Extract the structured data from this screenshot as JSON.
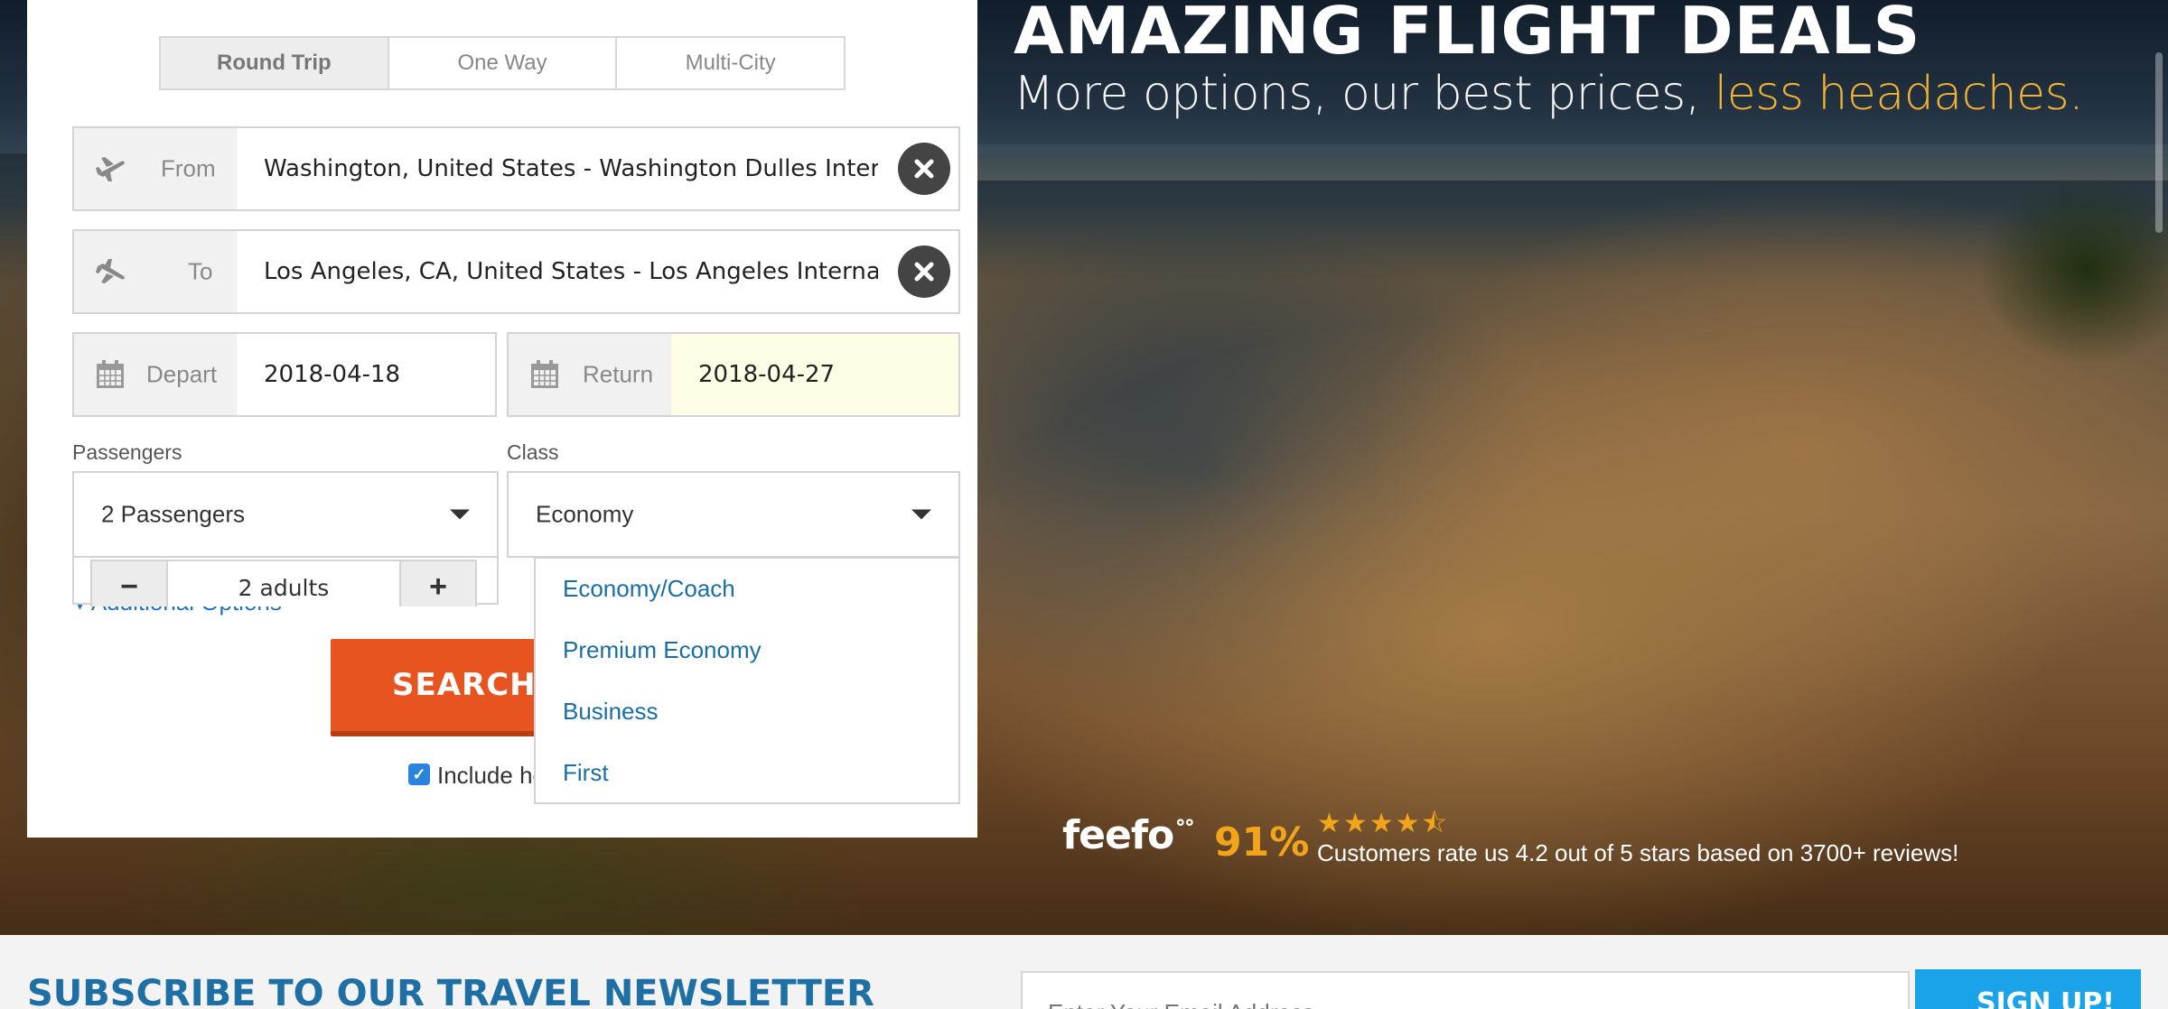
{
  "hero": {
    "title": "AMAZING FLIGHT DEALS",
    "subtitle_main": "More options, our best prices, ",
    "subtitle_accent": "less headaches.",
    "accent_color": "#f2b233"
  },
  "search": {
    "trip_tabs": [
      "Round Trip",
      "One Way",
      "Multi-City"
    ],
    "active_tab": "Round Trip",
    "from": {
      "label": "From",
      "value": "Washington, United States - Washington Dulles International"
    },
    "to": {
      "label": "To",
      "value": "Los Angeles, CA, United States - Los Angeles International"
    },
    "depart": {
      "label": "Depart",
      "value": "2018-04-18"
    },
    "return": {
      "label": "Return",
      "value": "2018-04-27"
    },
    "passengers": {
      "label": "Passengers",
      "value": "2 Passengers",
      "adults": "2 adults",
      "minus": "−",
      "plus": "+"
    },
    "class": {
      "label": "Class",
      "value": "Economy",
      "options": [
        "Economy/Coach",
        "Premium Economy",
        "Business",
        "First"
      ]
    },
    "additional_options": "▾ Additional Options",
    "search_label": "SEARCH",
    "include_label": "Include hotel",
    "include_checked": true,
    "accent_color": "#e8541f"
  },
  "feefo": {
    "logo": "feefo",
    "logo_mark": "ᐤᐤ",
    "percent": "91%",
    "stars": "★★★★⯪",
    "rating": 4.2,
    "text": "Customers rate us 4.2 out of 5 stars based on 3700+ reviews!"
  },
  "newsletter": {
    "title": "SUBSCRIBE TO OUR TRAVEL NEWSLETTER",
    "placeholder": "Enter Your Email Address",
    "button": "SIGN UP!"
  }
}
